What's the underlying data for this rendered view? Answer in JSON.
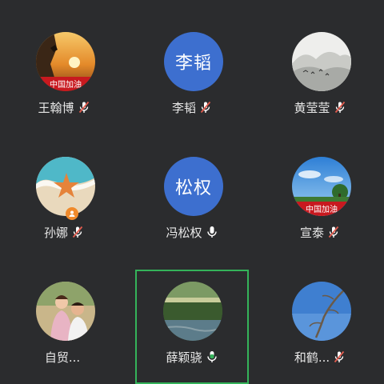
{
  "participants": [
    {
      "name": "王翰博",
      "avatar_type": "image",
      "avatar_icon": "sunset-climber-avatar",
      "banner": "中国加油",
      "mic": "muted"
    },
    {
      "name": "李韬",
      "avatar_type": "text",
      "avatar_text": "李韬",
      "mic": "muted"
    },
    {
      "name": "黄莹莹",
      "avatar_type": "image",
      "avatar_icon": "ink-landscape-avatar",
      "mic": "muted"
    },
    {
      "name": "孙娜",
      "avatar_type": "image",
      "avatar_icon": "starfish-beach-avatar",
      "mic": "muted",
      "badge": "host-badge-icon"
    },
    {
      "name": "冯松权",
      "avatar_type": "text",
      "avatar_text": "松权",
      "mic": "on"
    },
    {
      "name": "宣泰",
      "avatar_type": "image",
      "avatar_icon": "blue-sky-tree-avatar",
      "banner": "中国加油",
      "mic": "muted"
    },
    {
      "name": "自贸...",
      "avatar_type": "image",
      "avatar_icon": "family-photo-avatar",
      "mic": "none"
    },
    {
      "name": "薛颖骁",
      "avatar_type": "image",
      "avatar_icon": "pond-avatar",
      "mic": "speaking",
      "active": true
    },
    {
      "name": "和鹤...",
      "avatar_type": "image",
      "avatar_icon": "branch-sky-avatar",
      "mic": "muted"
    }
  ],
  "colors": {
    "background": "#2b2c2e",
    "text_avatar": "#3d6fcf",
    "muted_icon": "#e25c4f",
    "speaking": "#34b35a",
    "mic_on": "#ffffff",
    "banner": "#c8191f"
  }
}
